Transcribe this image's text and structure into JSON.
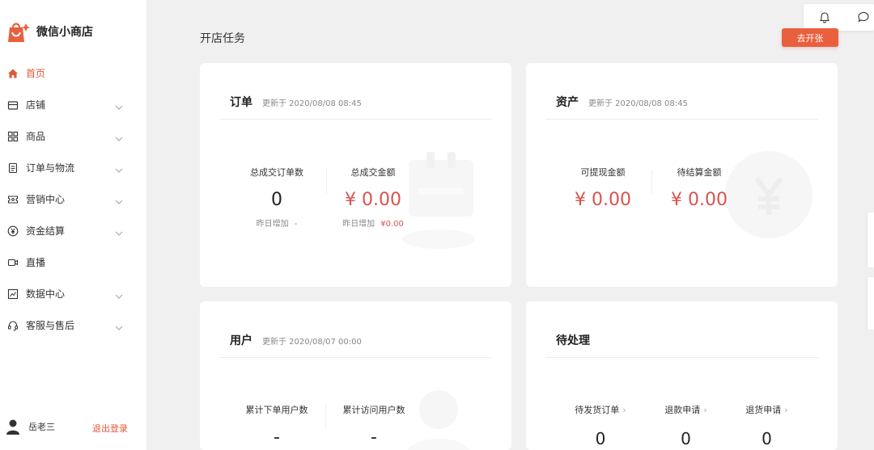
{
  "brand": {
    "name": "微信小商店"
  },
  "sidebar": {
    "items": [
      {
        "label": "首页",
        "icon": "home-icon"
      },
      {
        "label": "店铺",
        "icon": "store-icon"
      },
      {
        "label": "商品",
        "icon": "grid-icon"
      },
      {
        "label": "订单与物流",
        "icon": "order-icon"
      },
      {
        "label": "营销中心",
        "icon": "coupon-icon"
      },
      {
        "label": "资金结算",
        "icon": "yuan-icon"
      },
      {
        "label": "直播",
        "icon": "video-icon"
      },
      {
        "label": "数据中心",
        "icon": "chart-icon"
      },
      {
        "label": "客服与售后",
        "icon": "headset-icon"
      }
    ],
    "user": {
      "name": "岳老三",
      "logout": "退出登录"
    }
  },
  "header": {
    "title": "开店任务",
    "open_button": "去开张"
  },
  "cards": {
    "orders": {
      "title": "订单",
      "updated": "更新于 2020/08/08 08:45",
      "metrics": [
        {
          "label": "总成交订单数",
          "value": "0",
          "sub_label": "昨日增加",
          "sub_value": "-"
        },
        {
          "label": "总成交金额",
          "value": "¥ 0.00",
          "sub_label": "昨日增加",
          "sub_value": "¥0.00"
        }
      ]
    },
    "assets": {
      "title": "资产",
      "updated": "更新于 2020/08/08 08:45",
      "metrics": [
        {
          "label": "可提现金额",
          "value": "¥ 0.00"
        },
        {
          "label": "待结算金额",
          "value": "¥ 0.00"
        }
      ]
    },
    "users": {
      "title": "用户",
      "updated": "更新于 2020/08/07 00:00",
      "metrics": [
        {
          "label": "累计下单用户数",
          "value": "-"
        },
        {
          "label": "累计访问用户数",
          "value": "-"
        }
      ]
    },
    "pending": {
      "title": "待处理",
      "metrics": [
        {
          "label": "待发货订单",
          "value": "0"
        },
        {
          "label": "退款申请",
          "value": "0"
        },
        {
          "label": "退货申请",
          "value": "0"
        }
      ]
    }
  },
  "colors": {
    "accent": "#e8603d",
    "money": "#d9534f"
  }
}
